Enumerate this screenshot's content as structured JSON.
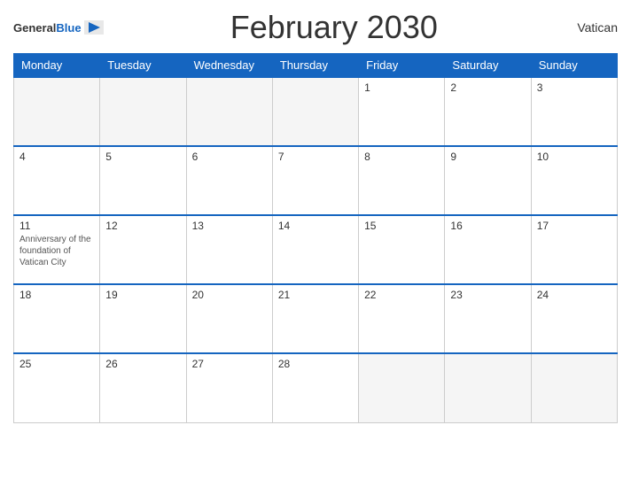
{
  "header": {
    "logo_general": "General",
    "logo_blue": "Blue",
    "title": "February 2030",
    "region": "Vatican"
  },
  "days_of_week": [
    "Monday",
    "Tuesday",
    "Wednesday",
    "Thursday",
    "Friday",
    "Saturday",
    "Sunday"
  ],
  "weeks": [
    [
      {
        "day": "",
        "empty": true
      },
      {
        "day": "",
        "empty": true
      },
      {
        "day": "",
        "empty": true
      },
      {
        "day": "",
        "empty": true
      },
      {
        "day": "1",
        "empty": false,
        "event": ""
      },
      {
        "day": "2",
        "empty": false,
        "event": ""
      },
      {
        "day": "3",
        "empty": false,
        "event": ""
      }
    ],
    [
      {
        "day": "4",
        "empty": false,
        "event": ""
      },
      {
        "day": "5",
        "empty": false,
        "event": ""
      },
      {
        "day": "6",
        "empty": false,
        "event": ""
      },
      {
        "day": "7",
        "empty": false,
        "event": ""
      },
      {
        "day": "8",
        "empty": false,
        "event": ""
      },
      {
        "day": "9",
        "empty": false,
        "event": ""
      },
      {
        "day": "10",
        "empty": false,
        "event": ""
      }
    ],
    [
      {
        "day": "11",
        "empty": false,
        "event": "Anniversary of the foundation of Vatican City"
      },
      {
        "day": "12",
        "empty": false,
        "event": ""
      },
      {
        "day": "13",
        "empty": false,
        "event": ""
      },
      {
        "day": "14",
        "empty": false,
        "event": ""
      },
      {
        "day": "15",
        "empty": false,
        "event": ""
      },
      {
        "day": "16",
        "empty": false,
        "event": ""
      },
      {
        "day": "17",
        "empty": false,
        "event": ""
      }
    ],
    [
      {
        "day": "18",
        "empty": false,
        "event": ""
      },
      {
        "day": "19",
        "empty": false,
        "event": ""
      },
      {
        "day": "20",
        "empty": false,
        "event": ""
      },
      {
        "day": "21",
        "empty": false,
        "event": ""
      },
      {
        "day": "22",
        "empty": false,
        "event": ""
      },
      {
        "day": "23",
        "empty": false,
        "event": ""
      },
      {
        "day": "24",
        "empty": false,
        "event": ""
      }
    ],
    [
      {
        "day": "25",
        "empty": false,
        "event": ""
      },
      {
        "day": "26",
        "empty": false,
        "event": ""
      },
      {
        "day": "27",
        "empty": false,
        "event": ""
      },
      {
        "day": "28",
        "empty": false,
        "event": ""
      },
      {
        "day": "",
        "empty": true
      },
      {
        "day": "",
        "empty": true
      },
      {
        "day": "",
        "empty": true
      }
    ]
  ]
}
